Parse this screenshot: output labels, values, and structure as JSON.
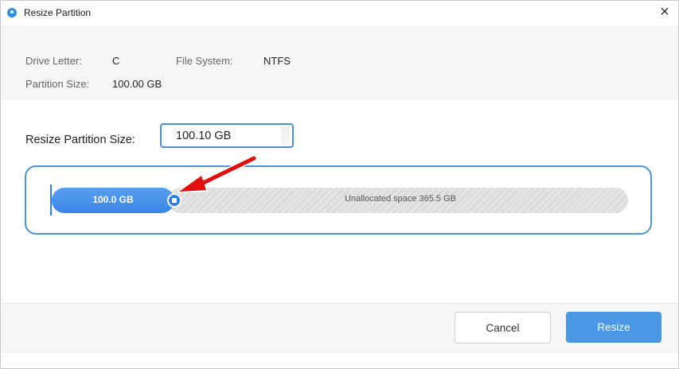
{
  "window": {
    "title": "Resize Partition",
    "close_glyph": "×"
  },
  "info": {
    "drive_letter_label": "Drive Letter:",
    "drive_letter_value": "C",
    "file_system_label": "File System:",
    "file_system_value": "NTFS",
    "partition_size_label": "Partition Size:",
    "partition_size_value": "100.00 GB"
  },
  "resize": {
    "label": "Resize Partition Size:",
    "input_value": "100.10 GB"
  },
  "disk_map": {
    "partition_label": "100.0 GB",
    "unallocated_label": "Unallocated space 365.5 GB",
    "partition_color": "#3a86e6",
    "unallocated_color": "#e3e3e3",
    "annotation_arrow_color": "#e01010"
  },
  "buttons": {
    "cancel": "Cancel",
    "resize": "Resize"
  },
  "colors": {
    "accent": "#4a97e6",
    "border_accent": "#4a90d9"
  }
}
